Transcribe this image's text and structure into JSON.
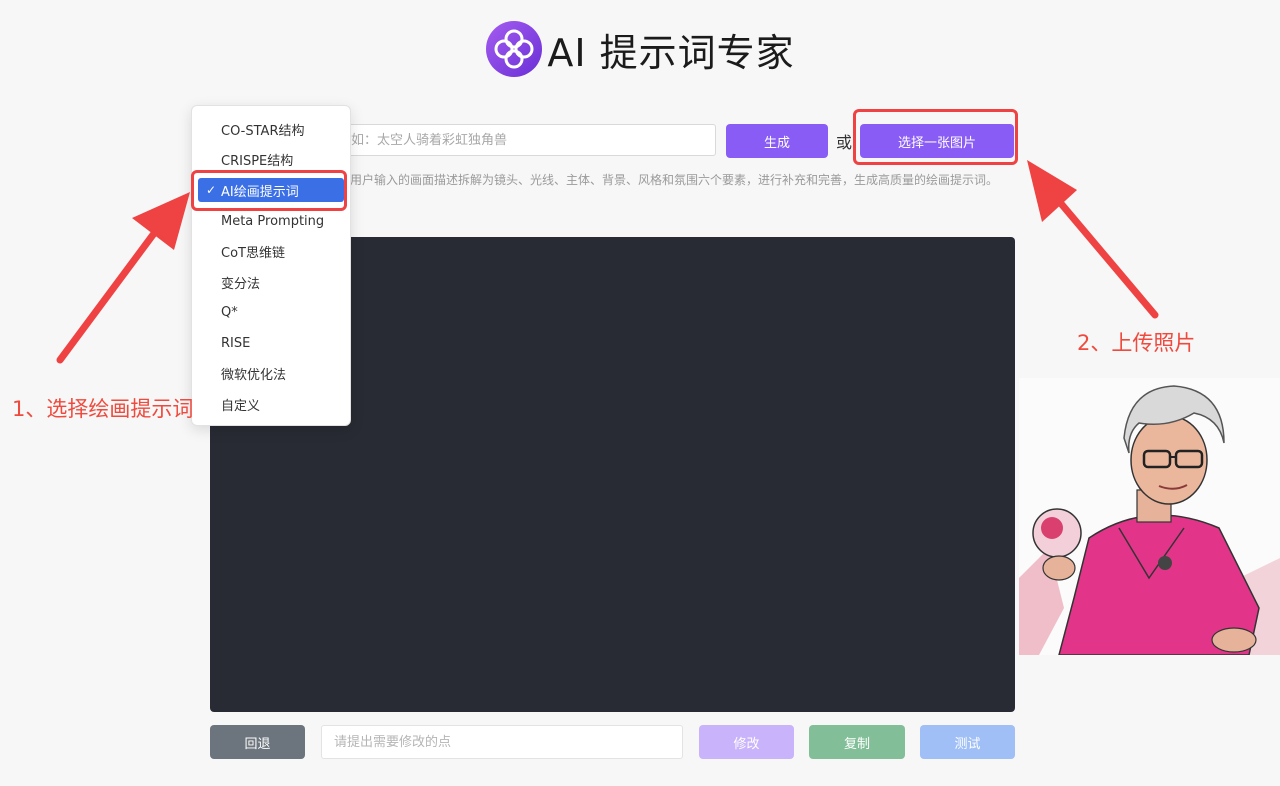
{
  "header": {
    "title": "AI 提示词专家",
    "logo_icon": "flower-logo-icon"
  },
  "top_row": {
    "prompt_placeholder": "如：太空人骑着彩虹独角兽",
    "generate_label": "生成",
    "or_label": "或",
    "upload_label": "选择一张图片"
  },
  "description": "将用户输入的画面描述拆解为镜头、光线、主体、背景、风格和氛围六个要素，进行补充和完善，生成高质量的绘画提示词。",
  "dropdown": {
    "selected": "AI绘画提示词",
    "items": [
      {
        "label": "CO-STAR结构"
      },
      {
        "label": "CRISPE结构"
      },
      {
        "label": "AI绘画提示词",
        "checked": true
      },
      {
        "label": "Meta Prompting"
      },
      {
        "label": "CoT思维链"
      },
      {
        "label": "变分法"
      },
      {
        "label": "Q*"
      },
      {
        "label": "RISE"
      },
      {
        "label": "微软优化法"
      },
      {
        "label": "自定义"
      }
    ]
  },
  "bottom_row": {
    "back_label": "回退",
    "modify_placeholder": "请提出需要修改的点",
    "modify_label": "修改",
    "copy_label": "复制",
    "test_label": "测试"
  },
  "annotations": {
    "step1": "1、选择绘画提示词",
    "step2": "2、上传照片"
  },
  "colors": {
    "accent_purple": "#8a5cf6",
    "annotation_red": "#ef4242",
    "dropdown_selected": "#3b6fe6",
    "output_bg": "#282b33"
  }
}
